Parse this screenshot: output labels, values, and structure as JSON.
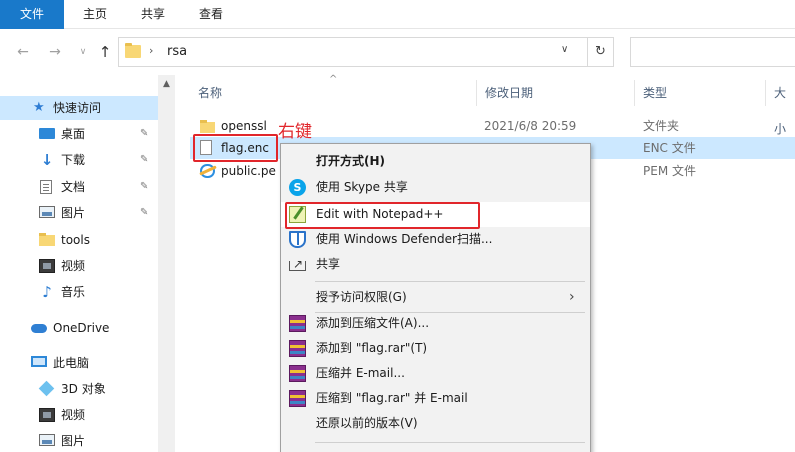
{
  "ribbon": {
    "tabs": [
      {
        "label": "文件"
      },
      {
        "label": "主页"
      },
      {
        "label": "共享"
      },
      {
        "label": "查看"
      }
    ]
  },
  "address_bar": {
    "back_icon": "arrow-left-icon",
    "forward_icon": "arrow-right-icon",
    "recent_icon": "chevron-down-icon",
    "up_icon": "arrow-up-icon",
    "path_separator": "›",
    "current_folder": "rsa",
    "dropdown_glyph": "⌄",
    "refresh_glyph": "↻"
  },
  "nav_pane": {
    "items": [
      {
        "label": "快速访问",
        "icon": "star-icon",
        "selected": true,
        "pinned": false
      },
      {
        "label": "桌面",
        "icon": "desktop-icon",
        "pinned": true
      },
      {
        "label": "下载",
        "icon": "download-icon",
        "pinned": true
      },
      {
        "label": "文档",
        "icon": "document-icon",
        "pinned": true
      },
      {
        "label": "图片",
        "icon": "picture-icon",
        "pinned": true
      },
      {
        "label": "tools",
        "icon": "folder-icon",
        "pinned": false
      },
      {
        "label": "视频",
        "icon": "video-icon",
        "pinned": false
      },
      {
        "label": "音乐",
        "icon": "music-icon",
        "pinned": false
      },
      {
        "label": "OneDrive",
        "icon": "cloud-icon",
        "pinned": false
      },
      {
        "label": "此电脑",
        "icon": "computer-icon",
        "pinned": false
      },
      {
        "label": "3D 对象",
        "icon": "3d-objects-icon",
        "pinned": false
      },
      {
        "label": "视频",
        "icon": "video-icon",
        "pinned": false
      },
      {
        "label": "图片",
        "icon": "picture-icon",
        "pinned": false
      }
    ],
    "pin_glyph": "📌"
  },
  "columns": {
    "name": "名称",
    "date": "修改日期",
    "type": "类型",
    "size": "大小",
    "sort_glyph": "^"
  },
  "files": [
    {
      "name": "openssl",
      "date": "2021/6/8 20:59",
      "type": "文件夹",
      "icon": "folder-icon"
    },
    {
      "name": "flag.enc",
      "date": "",
      "type": "ENC 文件",
      "icon": "file-icon"
    },
    {
      "name": "public.pe",
      "date": "",
      "type": "PEM 文件",
      "icon": "internet-explorer-icon"
    }
  ],
  "annotation": {
    "text": "右键",
    "color": "#e1262b"
  },
  "context_menu": {
    "items": [
      {
        "label": "打开方式(H)",
        "bold": true,
        "icon": ""
      },
      {
        "label": "使用 Skype 共享",
        "icon": "skype-icon"
      },
      {
        "label": "Edit with Notepad++",
        "icon": "notepad-plus-plus-icon",
        "highlighted": true
      },
      {
        "label": "使用 Windows Defender扫描...",
        "icon": "windows-defender-icon"
      },
      {
        "label": "共享",
        "icon": "share-icon"
      },
      {
        "label": "授予访问权限(G)",
        "icon": "",
        "submenu": true
      },
      {
        "label": "添加到压缩文件(A)...",
        "icon": "winrar-icon"
      },
      {
        "label": "添加到 \"flag.rar\"(T)",
        "icon": "winrar-icon"
      },
      {
        "label": "压缩并 E-mail...",
        "icon": "winrar-icon"
      },
      {
        "label": "压缩到 \"flag.rar\" 并 E-mail",
        "icon": "winrar-icon"
      },
      {
        "label": "还原以前的版本(V)",
        "icon": ""
      }
    ],
    "submenu_glyph": "›"
  },
  "colors": {
    "accent": "#1979ca",
    "selection": "#cce8ff",
    "annotation_red": "#e1262b"
  }
}
